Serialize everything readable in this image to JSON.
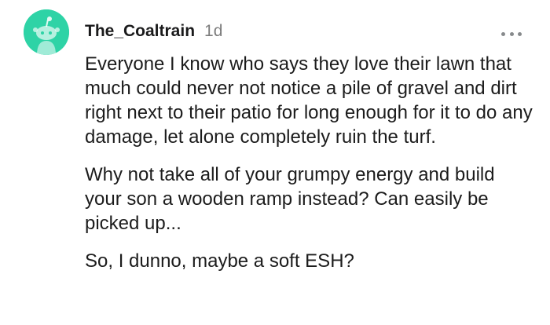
{
  "comment": {
    "username": "The_Coaltrain",
    "timestamp": "1d",
    "avatar_icon": "reddit-snoo-avatar",
    "avatar_color": "#2ed3a6",
    "more_icon": "more-options-icon",
    "paragraphs": [
      "Everyone I know who says they love their lawn that much could never not notice a pile of gravel and dirt right next to their patio for long enough for it to do any damage, let alone completely ruin the turf.",
      "Why not take all of your grumpy energy and build your son a wooden ramp instead? Can easily be picked up...",
      "So, I dunno, maybe a soft ESH?"
    ]
  }
}
